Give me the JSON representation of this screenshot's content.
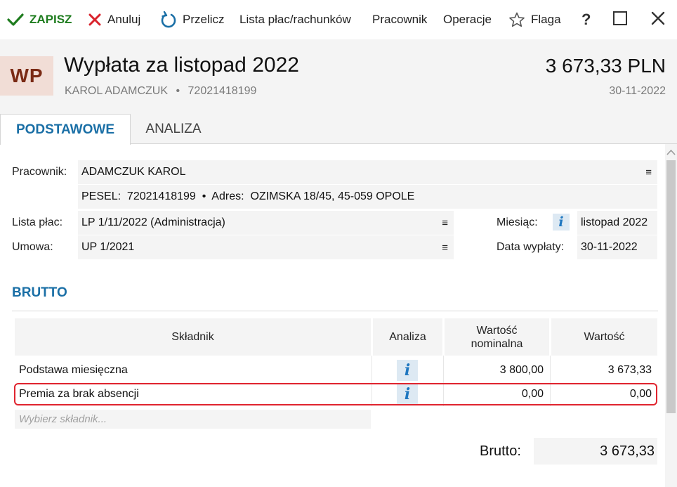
{
  "toolbar": {
    "save": "ZAPISZ",
    "cancel": "Anuluj",
    "recalc": "Przelicz",
    "payroll_list": "Lista płac/rachunków",
    "employee": "Pracownik",
    "operations": "Operacje",
    "flag": "Flaga",
    "help": "?"
  },
  "header": {
    "badge": "WP",
    "title": "Wypłata za listopad 2022",
    "employee_name": "KAROL ADAMCZUK",
    "separator": "•",
    "pesel": "72021418199",
    "amount": "3 673,33 PLN",
    "date": "30-11-2022"
  },
  "tabs": [
    {
      "label": "PODSTAWOWE",
      "active": true
    },
    {
      "label": "ANALIZA",
      "active": false
    }
  ],
  "form": {
    "employee_label": "Pracownik:",
    "employee_value": "ADAMCZUK KAROL",
    "details": "PESEL:  72021418199  •  Adres:  OZIMSKA 18/45, 45-059 OPOLE",
    "payroll_label": "Lista płac:",
    "payroll_value": "LP 1/11/2022 (Administracja)",
    "contract_label": "Umowa:",
    "contract_value": "UP 1/2021",
    "month_label": "Miesiąc:",
    "month_value": "listopad 2022",
    "paydate_label": "Data wypłaty:",
    "paydate_value": "30-11-2022",
    "menu_glyph": "≡",
    "info_glyph": "i"
  },
  "brutto": {
    "section_title": "BRUTTO",
    "columns": [
      "Składnik",
      "Analiza",
      "Wartość nominalna",
      "Wartość"
    ],
    "rows": [
      {
        "name": "Podstawa miesięczna",
        "nominal": "3 800,00",
        "value": "3 673,33"
      },
      {
        "name": "Premia za brak absencji",
        "nominal": "0,00",
        "value": "0,00"
      }
    ],
    "placeholder": "Wybierz składnik...",
    "total_label": "Brutto:",
    "total_value": "3 673,33"
  },
  "colors": {
    "accent": "#1a6fa6",
    "save_green": "#1e7c1e",
    "cancel_red": "#d9232d",
    "highlight_red": "#e0242f",
    "badge_bg": "#f1ddd6",
    "badge_text": "#7a2a14"
  }
}
